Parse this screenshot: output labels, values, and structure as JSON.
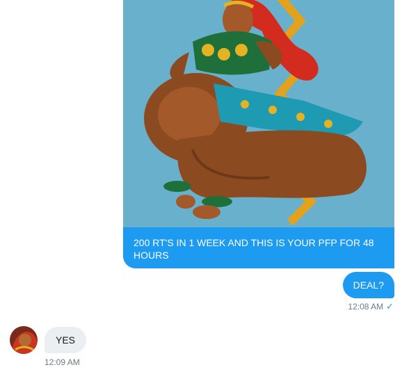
{
  "conversation": {
    "media_message": {
      "caption": "200 RT'S IN 1 WEEK AND THIS IS YOUR PFP FOR 48 HOURS",
      "image_description_icon": "illustration"
    },
    "outgoing_message": {
      "text": "DEAL?",
      "timestamp": "12:08 AM",
      "status_icon": "check-icon"
    },
    "incoming_message": {
      "text": "YES",
      "timestamp": "12:09 AM",
      "avatar_icon": "user-avatar"
    }
  },
  "colors": {
    "accent": "#1d9bf0",
    "bubble_incoming": "#eceff1",
    "media_background": "#69b0cd"
  }
}
